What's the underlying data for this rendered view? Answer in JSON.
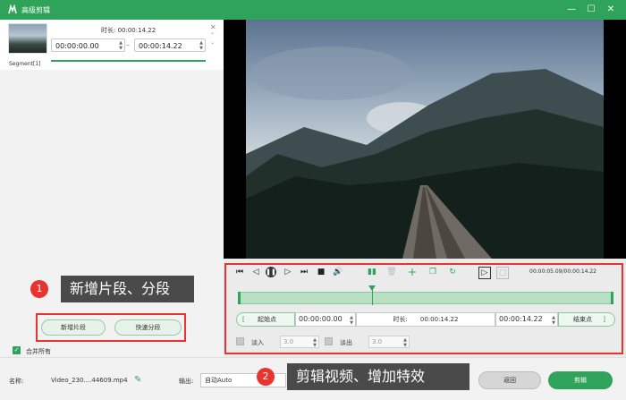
{
  "window": {
    "title": "高级剪辑"
  },
  "segment": {
    "label": "Segment[1]",
    "duration": "时长: 00:00:14.22",
    "start_time": "00:00:00.00",
    "end_time": "00:00:14.22",
    "separator": "–"
  },
  "player": {
    "time_readout": "00:00:05.09/00:00:14.22"
  },
  "clip": {
    "start_label": "起始点",
    "start_value": "00:00:00.00",
    "length_label": "时长:",
    "length_value": "00:00:14.22",
    "end_value": "00:00:14.22",
    "end_label": "结束点",
    "fade_in_label": "淡入",
    "fade_in_value": "3.0",
    "fade_out_label": "淡出",
    "fade_out_value": "3.0"
  },
  "actions": {
    "new_segment": "新增片段",
    "quick_split": "快速分段",
    "merge_all": "合并所有"
  },
  "callouts": {
    "one_number": "1",
    "one_text": "新增片段、分段",
    "two_number": "2",
    "two_text": "剪辑视频、增加特效"
  },
  "bottom": {
    "name_label": "名称:",
    "file_name": "Video_230....44609.mp4",
    "output_label": "输出:",
    "output_value": "自动Auto",
    "back_button": "返回",
    "cut_button": "剪辑"
  },
  "colors": {
    "accent": "#2fa35a",
    "callout_red": "#e8332e"
  }
}
